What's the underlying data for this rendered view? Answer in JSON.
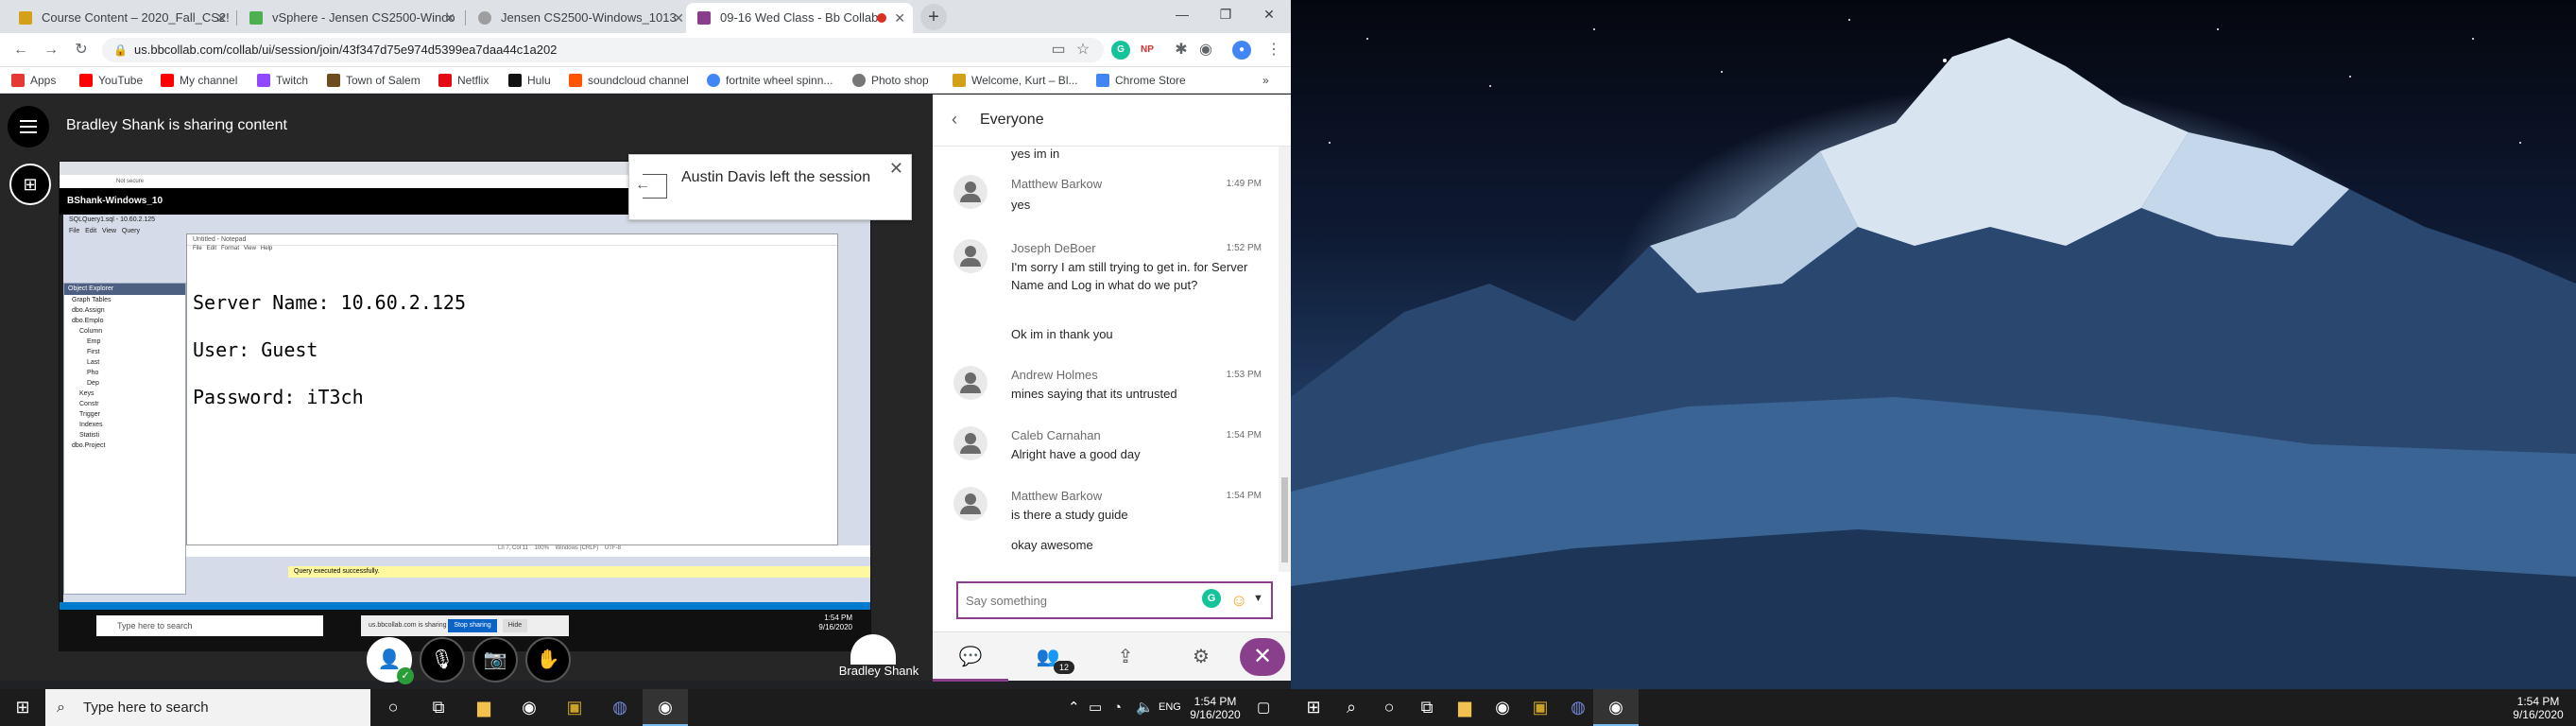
{
  "browser": {
    "tabs": [
      {
        "label": "Course Content – 2020_Fall_CS2!",
        "favicon_color": "#d4a017"
      },
      {
        "label": "vSphere - Jensen CS2500-Windo",
        "favicon_color": "#4caf50"
      },
      {
        "label": "Jensen CS2500-Windows_1013",
        "favicon_color": "#9e9e9e"
      },
      {
        "label": "09-16 Wed Class - Bb Collab",
        "favicon_color": "#8a3f8c"
      }
    ],
    "url": "us.bbcollab.com/collab/ui/session/join/43f347d75e974d5399ea7daa44c1a202",
    "bookmarks": [
      {
        "label": "Apps",
        "color": "#e53935"
      },
      {
        "label": "YouTube",
        "color": "#ff0000"
      },
      {
        "label": "My channel",
        "color": "#ff0000"
      },
      {
        "label": "Twitch",
        "color": "#9146ff"
      },
      {
        "label": "Town of Salem",
        "color": "#6d4c1f"
      },
      {
        "label": "Netflix",
        "color": "#e50914"
      },
      {
        "label": "Hulu",
        "color": "#111111"
      },
      {
        "label": "soundcloud channel",
        "color": "#ff5500"
      },
      {
        "label": "fortnite wheel spinn...",
        "color": "#4285f4"
      },
      {
        "label": "Photo shop",
        "color": "#777777"
      },
      {
        "label": "Welcome, Kurt – Bl...",
        "color": "#d4a017"
      },
      {
        "label": "Chrome Store",
        "color": "#4285f4"
      }
    ],
    "extensions": {
      "grammarly": "G",
      "np": "NP"
    }
  },
  "collab": {
    "sharing_title": "Bradley Shank is sharing content",
    "presenter_name": "Bradley Shank",
    "toast": "Austin Davis left the session",
    "shared_screen": {
      "vm_title": "BShank-Windows_10",
      "query_file": "SQLQuery1.sql - 10.60.2.125",
      "server_line": "Server Name: 10.60.2.125",
      "user_line": "User: Guest",
      "password_line": "Password: iT3ch",
      "query_status": "Query executed successfully.",
      "object_explorer": "Object Explorer",
      "tree_items": [
        "Graph Tables",
        "dbo.Assign",
        "dbo.Emplo",
        "Column",
        "Emp",
        "First",
        "Last",
        "Pho",
        "Dep",
        "Keys",
        "Constr",
        "Trigger",
        "Indexes",
        "Statisti",
        "dbo.Project"
      ],
      "search_placeholder": "Type here to search",
      "sharing_notice": "us.bbcollab.com is sharing your screen.",
      "stop_sharing": "Stop sharing",
      "hide": "Hide",
      "time": "1:54 PM",
      "date": "9/16/2020"
    }
  },
  "chat": {
    "title": "Everyone",
    "messages": [
      {
        "name": "",
        "time": "",
        "lines": [
          "yes im in"
        ]
      },
      {
        "name": "Matthew Barkow",
        "time": "1:49 PM",
        "lines": [
          "yes"
        ]
      },
      {
        "name": "Joseph DeBoer",
        "time": "1:52 PM",
        "lines": [
          "I'm sorry I am still trying to get in. for Server Name and Log in what do we put?",
          "Ok im in thank you"
        ]
      },
      {
        "name": "Andrew Holmes",
        "time": "1:53 PM",
        "lines": [
          "mines saying that its untrusted"
        ]
      },
      {
        "name": "Caleb Carnahan",
        "time": "1:54 PM",
        "lines": [
          "Alright have a good day"
        ]
      },
      {
        "name": "Matthew Barkow",
        "time": "1:54 PM",
        "lines": [
          "is there a study guide",
          "okay awesome"
        ]
      }
    ],
    "input_placeholder": "Say something",
    "attendee_count": "12"
  },
  "taskbar_left": {
    "search_placeholder": "Type here to search",
    "time": "1:54 PM",
    "date": "9/16/2020"
  },
  "taskbar_right": {
    "time": "1:54 PM",
    "date": "9/16/2020"
  },
  "colors": {
    "accent": "#8a3f8c",
    "taskbar": "#1c1c1c"
  }
}
